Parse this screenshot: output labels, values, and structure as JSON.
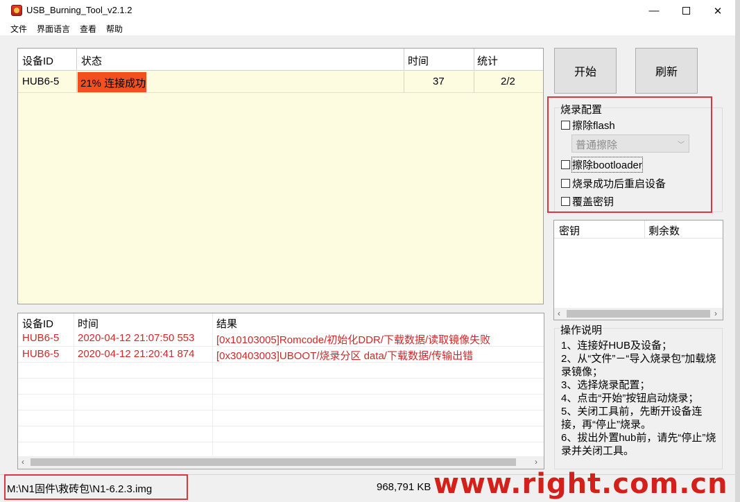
{
  "window": {
    "title": "USB_Burning_Tool_v2.1.2",
    "min_glyph": "—",
    "close_glyph": "✕"
  },
  "menu": [
    "文件",
    "界面语言",
    "查看",
    "帮助"
  ],
  "device_table": {
    "columns": [
      "设备ID",
      "状态",
      "时间",
      "统计"
    ],
    "rows": [
      {
        "id": "HUB6-5",
        "status": "21% 连接成功",
        "progress": 0.21,
        "time": "37",
        "stat": "2/2"
      }
    ]
  },
  "buttons": {
    "start": "开始",
    "refresh": "刷新"
  },
  "burn_config": {
    "title": "烧录配置",
    "erase_flash": "擦除flash",
    "erase_mode": "普通擦除",
    "erase_bootloader": "擦除bootloader",
    "reboot_after": "烧录成功后重启设备",
    "overwrite_key": "覆盖密钥"
  },
  "key_table": {
    "columns": [
      "密钥",
      "剩余数"
    ]
  },
  "instructions": {
    "title": "操作说明",
    "lines": [
      "1、连接好HUB及设备；",
      "2、从“文件”－“导入烧录包”加载烧录镜像；",
      "3、选择烧录配置；",
      "4、点击“开始”按钮启动烧录；",
      "5、关闭工具前，先断开设备连接，再“停止”烧录。",
      "6、拔出外置hub前，请先“停止”烧录并关闭工具。"
    ]
  },
  "log_table": {
    "columns": [
      "设备ID",
      "时间",
      "结果"
    ],
    "rows": [
      {
        "id": "HUB6-5",
        "time": "2020-04-12 21:07:50 553",
        "result": "[0x10103005]Romcode/初始化DDR/下载数据/读取镜像失败"
      },
      {
        "id": "HUB6-5",
        "time": "2020-04-12 21:20:41 874",
        "result": "[0x30403003]UBOOT/烧录分区 data/下载数据/传输出错"
      }
    ]
  },
  "status": {
    "path": "M:\\N1固件\\救砖包\\N1-6.2.3.img",
    "size": "968,791 KB"
  },
  "watermark": "www.right.com.cn",
  "colors": {
    "progress": "#f2501e",
    "error_text": "#d02828",
    "highlight_box": "#d9363e",
    "device_bg": "#fefce0"
  }
}
